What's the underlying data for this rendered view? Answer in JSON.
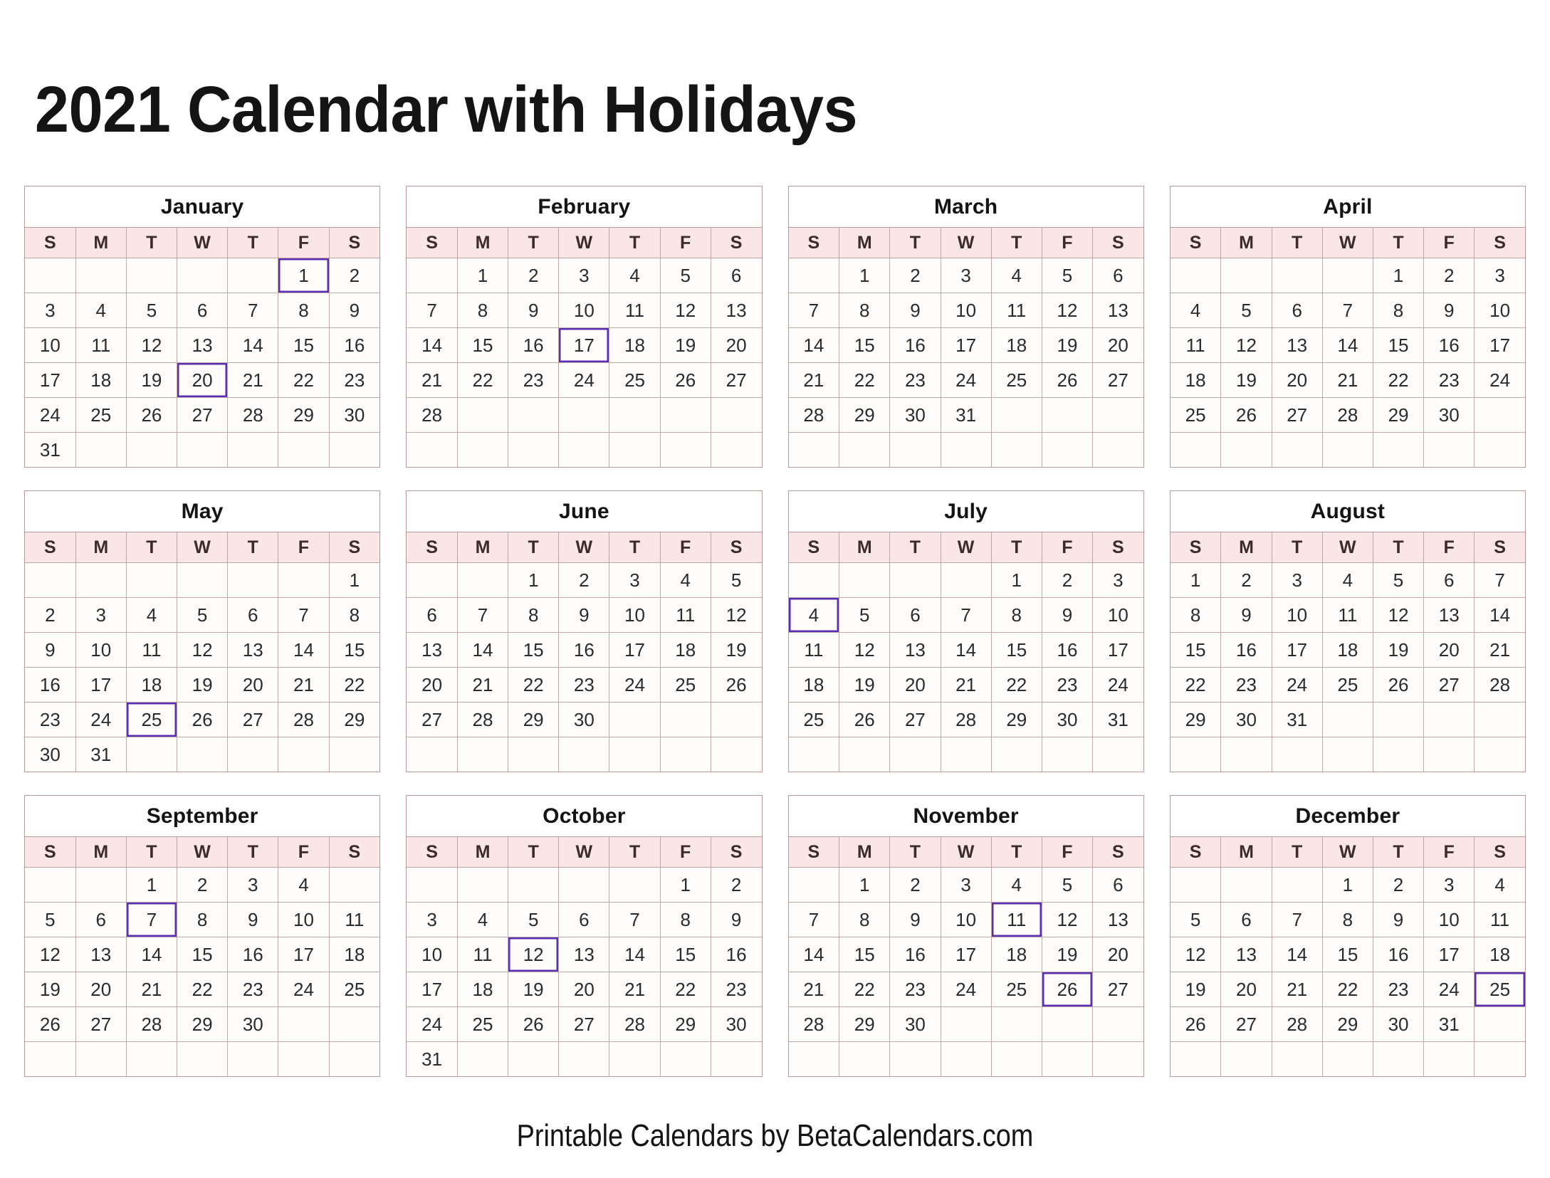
{
  "page": {
    "title": "2021 Calendar with Holidays",
    "footer": "Printable Calendars by BetaCalendars.com",
    "year": "2021"
  },
  "colors": {
    "weekday_header_bg": "#fae6e6",
    "weekday_header_text": "#3b2b2b",
    "grid_border": "#c3a8a8",
    "block_border": "#b8999b",
    "cell_bg": "#fefdfc",
    "holiday_border": "#5b2fb3",
    "holiday_bg": "#fdeef4",
    "holiday_text": "#6b4fd8",
    "title_text": "#141414"
  },
  "weekday_headers": [
    "S",
    "M",
    "T",
    "W",
    "T",
    "F",
    "S"
  ],
  "months": [
    {
      "name": "January",
      "weeks": [
        [
          "",
          "",
          "",
          "",
          "",
          "1",
          "2"
        ],
        [
          "3",
          "4",
          "5",
          "6",
          "7",
          "8",
          "9"
        ],
        [
          "10",
          "11",
          "12",
          "13",
          "14",
          "15",
          "16"
        ],
        [
          "17",
          "18",
          "19",
          "20",
          "21",
          "22",
          "23"
        ],
        [
          "24",
          "25",
          "26",
          "27",
          "28",
          "29",
          "30"
        ],
        [
          "31",
          "",
          "",
          "",
          "",
          "",
          ""
        ]
      ],
      "holidays": [
        "1",
        "20"
      ]
    },
    {
      "name": "February",
      "weeks": [
        [
          "",
          "1",
          "2",
          "3",
          "4",
          "5",
          "6"
        ],
        [
          "7",
          "8",
          "9",
          "10",
          "11",
          "12",
          "13"
        ],
        [
          "14",
          "15",
          "16",
          "17",
          "18",
          "19",
          "20"
        ],
        [
          "21",
          "22",
          "23",
          "24",
          "25",
          "26",
          "27"
        ],
        [
          "28",
          "",
          "",
          "",
          "",
          "",
          ""
        ],
        [
          "",
          "",
          "",
          "",
          "",
          "",
          ""
        ]
      ],
      "holidays": [
        "17"
      ]
    },
    {
      "name": "March",
      "weeks": [
        [
          "",
          "1",
          "2",
          "3",
          "4",
          "5",
          "6"
        ],
        [
          "7",
          "8",
          "9",
          "10",
          "11",
          "12",
          "13"
        ],
        [
          "14",
          "15",
          "16",
          "17",
          "18",
          "19",
          "20"
        ],
        [
          "21",
          "22",
          "23",
          "24",
          "25",
          "26",
          "27"
        ],
        [
          "28",
          "29",
          "30",
          "31",
          "",
          "",
          ""
        ],
        [
          "",
          "",
          "",
          "",
          "",
          "",
          ""
        ]
      ],
      "holidays": []
    },
    {
      "name": "April",
      "weeks": [
        [
          "",
          "",
          "",
          "",
          "1",
          "2",
          "3"
        ],
        [
          "4",
          "5",
          "6",
          "7",
          "8",
          "9",
          "10"
        ],
        [
          "11",
          "12",
          "13",
          "14",
          "15",
          "16",
          "17"
        ],
        [
          "18",
          "19",
          "20",
          "21",
          "22",
          "23",
          "24"
        ],
        [
          "25",
          "26",
          "27",
          "28",
          "29",
          "30",
          ""
        ],
        [
          "",
          "",
          "",
          "",
          "",
          "",
          ""
        ]
      ],
      "holidays": []
    },
    {
      "name": "May",
      "weeks": [
        [
          "",
          "",
          "",
          "",
          "",
          "",
          "1"
        ],
        [
          "2",
          "3",
          "4",
          "5",
          "6",
          "7",
          "8"
        ],
        [
          "9",
          "10",
          "11",
          "12",
          "13",
          "14",
          "15"
        ],
        [
          "16",
          "17",
          "18",
          "19",
          "20",
          "21",
          "22"
        ],
        [
          "23",
          "24",
          "25",
          "26",
          "27",
          "28",
          "29"
        ],
        [
          "30",
          "31",
          "",
          "",
          "",
          "",
          ""
        ]
      ],
      "holidays": [
        "25"
      ]
    },
    {
      "name": "June",
      "weeks": [
        [
          "",
          "",
          "1",
          "2",
          "3",
          "4",
          "5"
        ],
        [
          "6",
          "7",
          "8",
          "9",
          "10",
          "11",
          "12"
        ],
        [
          "13",
          "14",
          "15",
          "16",
          "17",
          "18",
          "19"
        ],
        [
          "20",
          "21",
          "22",
          "23",
          "24",
          "25",
          "26"
        ],
        [
          "27",
          "28",
          "29",
          "30",
          "",
          "",
          ""
        ],
        [
          "",
          "",
          "",
          "",
          "",
          "",
          ""
        ]
      ],
      "holidays": []
    },
    {
      "name": "July",
      "weeks": [
        [
          "",
          "",
          "",
          "",
          "1",
          "2",
          "3"
        ],
        [
          "4",
          "5",
          "6",
          "7",
          "8",
          "9",
          "10"
        ],
        [
          "11",
          "12",
          "13",
          "14",
          "15",
          "16",
          "17"
        ],
        [
          "18",
          "19",
          "20",
          "21",
          "22",
          "23",
          "24"
        ],
        [
          "25",
          "26",
          "27",
          "28",
          "29",
          "30",
          "31"
        ],
        [
          "",
          "",
          "",
          "",
          "",
          "",
          ""
        ]
      ],
      "holidays": [
        "4"
      ]
    },
    {
      "name": "August",
      "weeks": [
        [
          "1",
          "2",
          "3",
          "4",
          "5",
          "6",
          "7"
        ],
        [
          "8",
          "9",
          "10",
          "11",
          "12",
          "13",
          "14"
        ],
        [
          "15",
          "16",
          "17",
          "18",
          "19",
          "20",
          "21"
        ],
        [
          "22",
          "23",
          "24",
          "25",
          "26",
          "27",
          "28"
        ],
        [
          "29",
          "30",
          "31",
          "",
          "",
          "",
          ""
        ],
        [
          "",
          "",
          "",
          "",
          "",
          "",
          ""
        ]
      ],
      "holidays": []
    },
    {
      "name": "September",
      "weeks": [
        [
          "",
          "",
          "1",
          "2",
          "3",
          "4",
          ""
        ],
        [
          "5",
          "6",
          "7",
          "8",
          "9",
          "10",
          "11"
        ],
        [
          "12",
          "13",
          "14",
          "15",
          "16",
          "17",
          "18"
        ],
        [
          "19",
          "20",
          "21",
          "22",
          "23",
          "24",
          "25"
        ],
        [
          "26",
          "27",
          "28",
          "29",
          "30",
          "",
          ""
        ],
        [
          "",
          "",
          "",
          "",
          "",
          "",
          ""
        ]
      ],
      "holidays": [
        "7"
      ]
    },
    {
      "name": "October",
      "weeks": [
        [
          "",
          "",
          "",
          "",
          "",
          "1",
          "2"
        ],
        [
          "3",
          "4",
          "5",
          "6",
          "7",
          "8",
          "9"
        ],
        [
          "10",
          "11",
          "12",
          "13",
          "14",
          "15",
          "16"
        ],
        [
          "17",
          "18",
          "19",
          "20",
          "21",
          "22",
          "23"
        ],
        [
          "24",
          "25",
          "26",
          "27",
          "28",
          "29",
          "30"
        ],
        [
          "31",
          "",
          "",
          "",
          "",
          "",
          ""
        ]
      ],
      "holidays": [
        "12"
      ]
    },
    {
      "name": "November",
      "weeks": [
        [
          "",
          "1",
          "2",
          "3",
          "4",
          "5",
          "6"
        ],
        [
          "7",
          "8",
          "9",
          "10",
          "11",
          "12",
          "13"
        ],
        [
          "14",
          "15",
          "16",
          "17",
          "18",
          "19",
          "20"
        ],
        [
          "21",
          "22",
          "23",
          "24",
          "25",
          "26",
          "27"
        ],
        [
          "28",
          "29",
          "30",
          "",
          "",
          "",
          ""
        ],
        [
          "",
          "",
          "",
          "",
          "",
          "",
          ""
        ]
      ],
      "holidays": [
        "11",
        "26"
      ]
    },
    {
      "name": "December",
      "weeks": [
        [
          "",
          "",
          "",
          "1",
          "2",
          "3",
          "4"
        ],
        [
          "5",
          "6",
          "7",
          "8",
          "9",
          "10",
          "11"
        ],
        [
          "12",
          "13",
          "14",
          "15",
          "16",
          "17",
          "18"
        ],
        [
          "19",
          "20",
          "21",
          "22",
          "23",
          "24",
          "25"
        ],
        [
          "26",
          "27",
          "28",
          "29",
          "30",
          "31",
          ""
        ],
        [
          "",
          "",
          "",
          "",
          "",
          "",
          ""
        ]
      ],
      "holidays": [
        "25"
      ]
    }
  ]
}
